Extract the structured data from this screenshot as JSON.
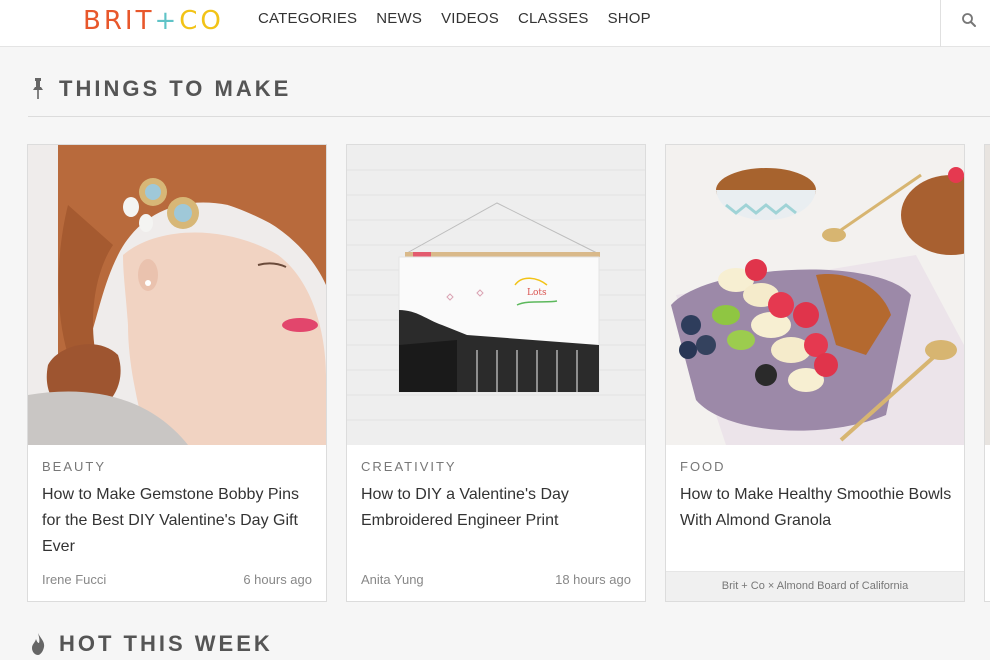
{
  "header": {
    "logo": {
      "part1": "BRIT",
      "plus": "+",
      "part2": "CO"
    },
    "nav": [
      "CATEGORIES",
      "NEWS",
      "VIDEOS",
      "CLASSES",
      "SHOP"
    ],
    "search_icon": "search-icon"
  },
  "sections": {
    "make": {
      "title": "THINGS TO MAKE",
      "icon": "pin-icon"
    },
    "hot": {
      "title": "HOT THIS WEEK",
      "icon": "flame-icon"
    }
  },
  "cards": [
    {
      "category": "BEAUTY",
      "title": "How to Make Gemstone Bobby Pins for the Best DIY Valentine's Day Gift Ever",
      "author": "Irene Fucci",
      "time": "6 hours ago"
    },
    {
      "category": "CREATIVITY",
      "title": "How to DIY a Valentine's Day Embroidered Engineer Print",
      "author": "Anita Yung",
      "time": "18 hours ago"
    },
    {
      "category": "FOOD",
      "title": "How to Make Healthy Smoothie Bowls With Almond Granola",
      "sponsor": "Brit + Co × Almond Board of California"
    }
  ],
  "colors": {
    "logo_red": "#e8572b",
    "logo_orange": "#f39a26",
    "logo_teal": "#5fc3c7",
    "logo_yellow": "#f2c317"
  }
}
